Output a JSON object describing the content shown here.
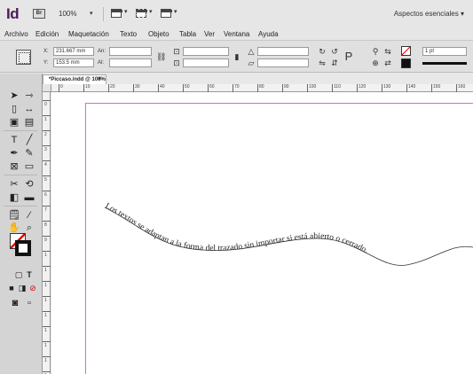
{
  "app": {
    "logo": "Id",
    "bridge": "Br",
    "zoom": "100%",
    "zoom_caret": "▾",
    "workspace": "Aspectos esenciales ▾"
  },
  "menu": [
    "Archivo",
    "Edición",
    "Maquetación",
    "Texto",
    "Objeto",
    "Tabla",
    "Ver",
    "Ventana",
    "Ayuda"
  ],
  "control": {
    "x_label": "X:",
    "x_value": "231.667 mm",
    "y_label": "Y:",
    "y_value": "153.5 mm",
    "w_label": "An:",
    "h_label": "Al:",
    "stroke_weight": "1 pt"
  },
  "document": {
    "tab_title": "*Piccaso.indd @ 100%",
    "tab_close": "×",
    "path_text": "Los textos se adaptan a la forma del trazado sin importar si está abierto o cerrado."
  },
  "ruler": {
    "h_marks": [
      "0",
      "10",
      "20",
      "30",
      "40",
      "50",
      "60",
      "70",
      "80",
      "90",
      "100",
      "110",
      "120",
      "130",
      "140",
      "150",
      "160",
      "170"
    ],
    "v_marks": [
      "0",
      "1",
      "2",
      "3",
      "4",
      "5",
      "6",
      "7",
      "8",
      "9",
      "1",
      "1",
      "1",
      "1",
      "1",
      "1",
      "1",
      "1",
      "1"
    ]
  },
  "colors": {
    "page_border": "#d26ad9",
    "logo": "#4a1a5a"
  }
}
